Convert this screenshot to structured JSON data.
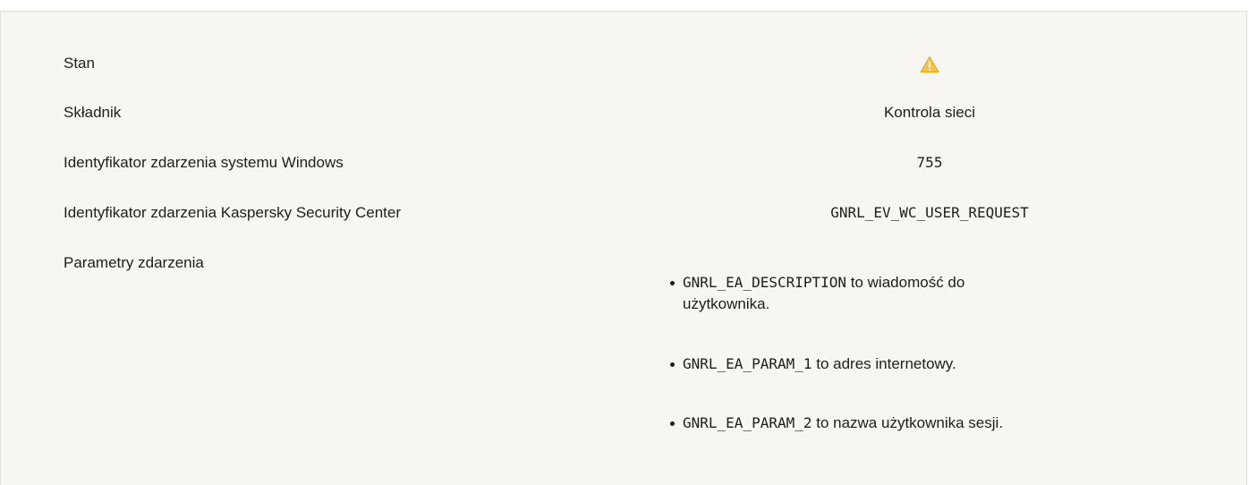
{
  "rows": [
    {
      "label": "Stan",
      "value_icon": "warning-icon",
      "value_color": "#f2b63c"
    },
    {
      "label": "Składnik",
      "value": "Kontrola sieci"
    },
    {
      "label": "Identyfikator zdarzenia systemu Windows",
      "value": "755"
    },
    {
      "label": "Identyfikator zdarzenia Kaspersky Security Center",
      "value": "GNRL_EV_WC_USER_REQUEST"
    },
    {
      "label": "Parametry zdarzenia"
    }
  ],
  "params": [
    {
      "code": "GNRL_EA_DESCRIPTION",
      "text_line1": " to wiadomość do",
      "text_line2": "użytkownika."
    },
    {
      "code": "GNRL_EA_PARAM_1",
      "text": " to adres internetowy."
    },
    {
      "code": "GNRL_EA_PARAM_2",
      "text": " to nazwa użytkownika sesji."
    }
  ]
}
